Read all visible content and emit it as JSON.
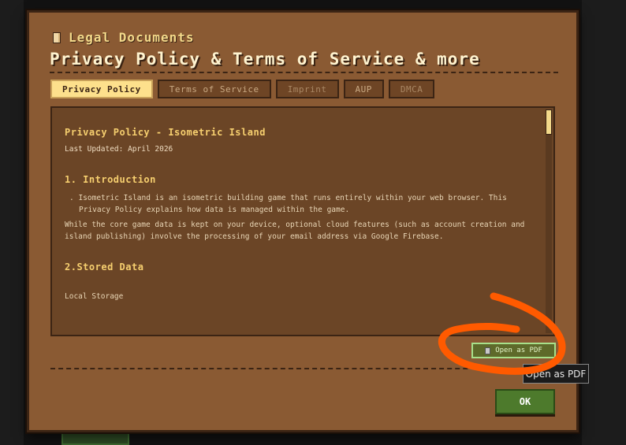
{
  "dialog": {
    "header_small": "Legal Documents",
    "header_big": "Privacy Policy & Terms of Service & more",
    "tabs": [
      {
        "label": "Privacy Policy",
        "active": true
      },
      {
        "label": "Terms of Service",
        "active": false
      },
      {
        "label": "Imprint",
        "active": false
      },
      {
        "label": "AUP",
        "active": false
      },
      {
        "label": "DMCA",
        "active": false
      }
    ],
    "content": {
      "title": "Privacy Policy - Isometric Island",
      "last_updated": "Last Updated: April 2026",
      "section1_heading": "1. Introduction",
      "section1_bullet": ". Isometric Island is an isometric building game that runs entirely within your web browser. This Privacy Policy explains how data is managed within the game.",
      "section1_para": "While the core game data is kept on your device, optional cloud features (such as account creation and island publishing) involve the processing of your email address via Google Firebase.",
      "section2_heading": "2.Stored Data",
      "section2_sub": "Local Storage"
    },
    "pdf_button": "Open as PDF",
    "ok_button": "OK",
    "tooltip": "Open as PDF"
  },
  "icons": {
    "header_icon": "document-icon",
    "pdf_icon": "document-icon"
  },
  "colors": {
    "dialog_bg": "#8a5a33",
    "content_bg": "#6b4526",
    "accent_yellow": "#f6cf6f",
    "active_tab": "#fde08c",
    "ok_green": "#4d7a2c",
    "annotation_orange": "#ff5a00"
  }
}
